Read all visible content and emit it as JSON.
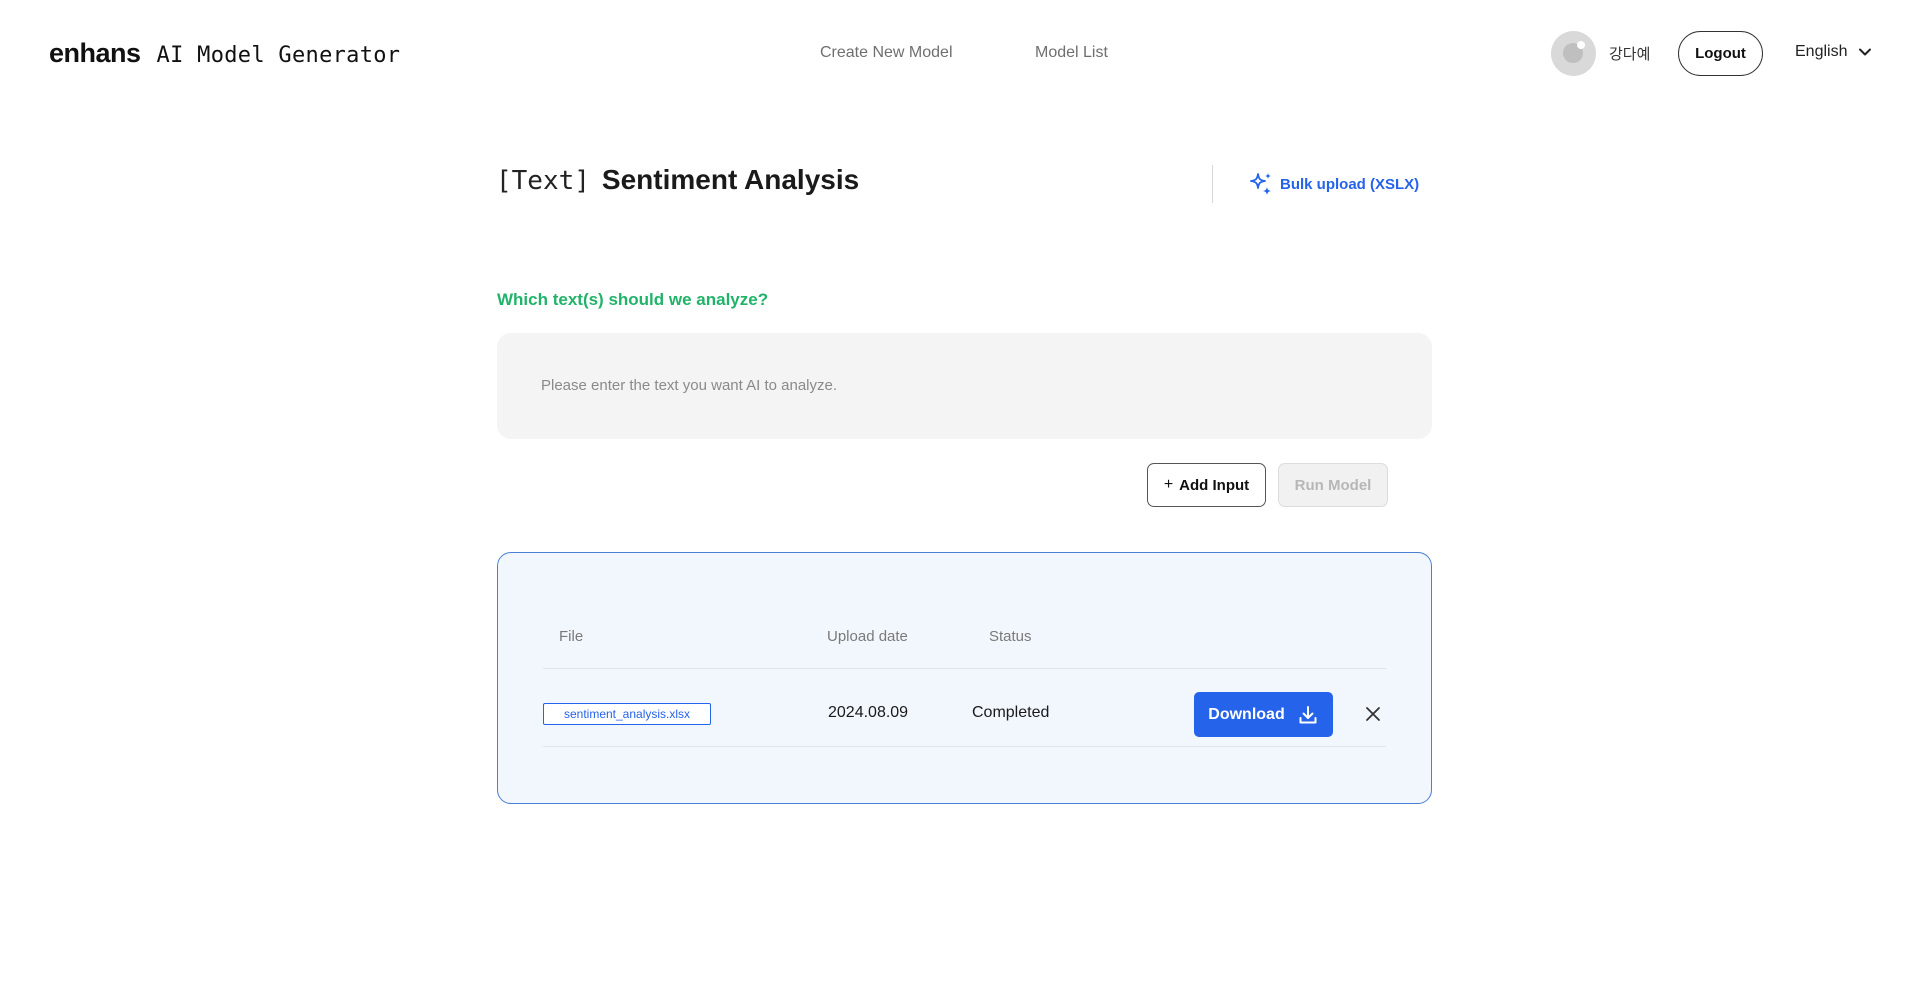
{
  "header": {
    "brand_logo": "enhans",
    "brand_subtitle": "AI Model Generator",
    "nav": {
      "create_new_model": "Create New Model",
      "model_list": "Model List"
    },
    "user": {
      "name": "강다예",
      "avatar_icon": "user-avatar-icon"
    },
    "logout_label": "Logout",
    "language": {
      "selected": "English",
      "icon": "chevron-down-icon"
    }
  },
  "page": {
    "title_tag": "[Text]",
    "title": "Sentiment Analysis",
    "bulk_upload_label": "Bulk upload (XSLX)",
    "bulk_upload_icon": "sparkle-icon"
  },
  "form": {
    "question": "Which text(s) should we analyze?",
    "input_placeholder": "Please enter the text you want AI to analyze.",
    "input_value": "",
    "add_input_symbol": "+",
    "add_input_label": "Add Input",
    "run_model_label": "Run Model"
  },
  "uploads": {
    "columns": [
      "File",
      "Upload date",
      "Status"
    ],
    "rows": [
      {
        "file": "sentiment_analysis.xlsx",
        "upload_date": "2024.08.09",
        "status": "Completed",
        "download_label": "Download",
        "download_icon": "download-icon",
        "remove_icon": "close-icon"
      }
    ]
  },
  "colors": {
    "accent_blue": "#2563eb",
    "question_green": "#22b36a",
    "panel_bg": "#f2f7fd",
    "panel_border": "#4a7fd6",
    "input_bg": "#f4f4f4"
  }
}
